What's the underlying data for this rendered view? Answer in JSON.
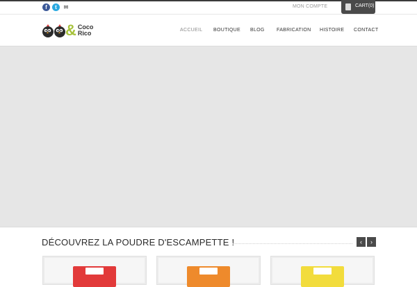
{
  "topbar": {
    "social": [
      {
        "name": "facebook-icon",
        "glyph": "f"
      },
      {
        "name": "twitter-icon",
        "glyph": "t"
      },
      {
        "name": "mail-icon",
        "glyph": "✉"
      }
    ],
    "account_label": "MON COMPTE",
    "cart_label": "CART(0)"
  },
  "logo": {
    "line1": "Coco",
    "ampersand": "&",
    "line2": "Rico",
    "accent_color": "#a7c23b"
  },
  "nav": {
    "items": [
      {
        "label": "ACCUEIL",
        "active": true
      },
      {
        "label": "BOUTIQUE",
        "active": false
      },
      {
        "label": "BLOG",
        "active": false
      },
      {
        "label": "FABRICATION",
        "active": false
      },
      {
        "label": "HISTOIRE",
        "active": false
      },
      {
        "label": "CONTACT",
        "active": false
      }
    ]
  },
  "section": {
    "title": "DÉCOUVREZ LA POUDRE D'ESCAMPETTE !",
    "prev_glyph": "‹",
    "next_glyph": "›"
  },
  "products": [
    {
      "color": "#e23a3a"
    },
    {
      "color": "#ee8a2c"
    },
    {
      "color": "#f2dc3c"
    }
  ]
}
